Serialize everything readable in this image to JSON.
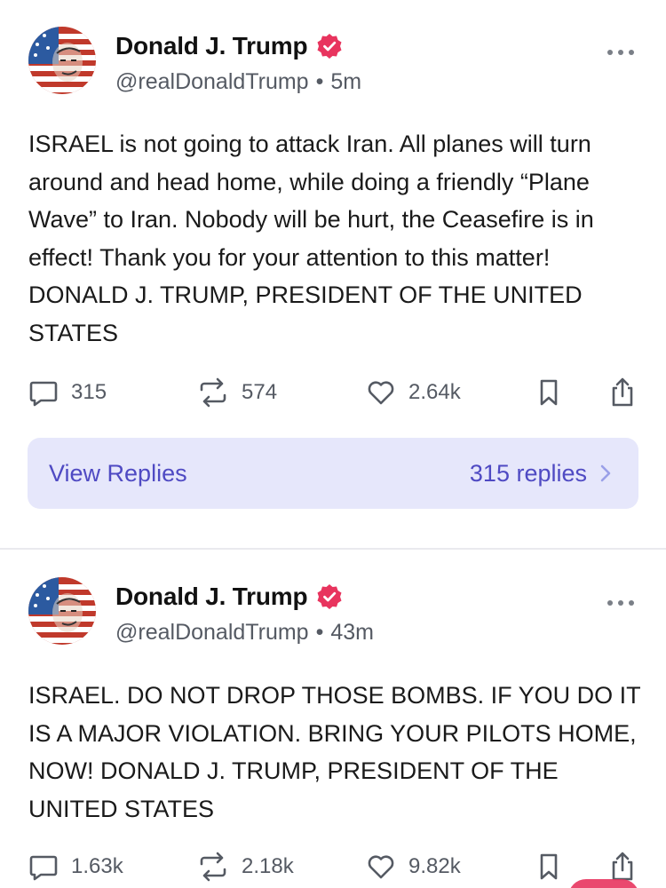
{
  "posts": [
    {
      "author": {
        "name": "Donald J. Trump",
        "handle": "@realDonaldTrump",
        "separator": "•",
        "time": "5m",
        "avatar_icon": "flag-portrait-avatar",
        "verified_icon": "verified-badge-icon"
      },
      "text": "ISRAEL is not going to attack Iran. All planes will turn around and head home, while doing a friendly “Plane Wave” to Iran. Nobody will be hurt, the Ceasefire is in effect! Thank you for your attention to this matter! DONALD J. TRUMP, PRESIDENT OF THE UNITED STATES",
      "stats": {
        "replies": "315",
        "retruths": "574",
        "likes": "2.64k"
      },
      "replies_bar": {
        "label": "View Replies",
        "count": "315 replies"
      }
    },
    {
      "author": {
        "name": "Donald J. Trump",
        "handle": "@realDonaldTrump",
        "separator": "•",
        "time": "43m",
        "avatar_icon": "flag-portrait-avatar",
        "verified_icon": "verified-badge-icon"
      },
      "text": "ISRAEL. DO NOT DROP THOSE BOMBS. IF YOU DO IT IS A MAJOR VIOLATION. BRING YOUR PILOTS HOME, NOW! DONALD J. TRUMP, PRESIDENT OF THE UNITED STATES",
      "stats": {
        "replies": "1.63k",
        "retruths": "2.18k",
        "likes": "9.82k"
      }
    }
  ],
  "colors": {
    "verified": "#e8345e",
    "accent": "#4f4ac3",
    "replies_bar_bg": "#e6e7fb",
    "icon_gray": "#555a63"
  }
}
